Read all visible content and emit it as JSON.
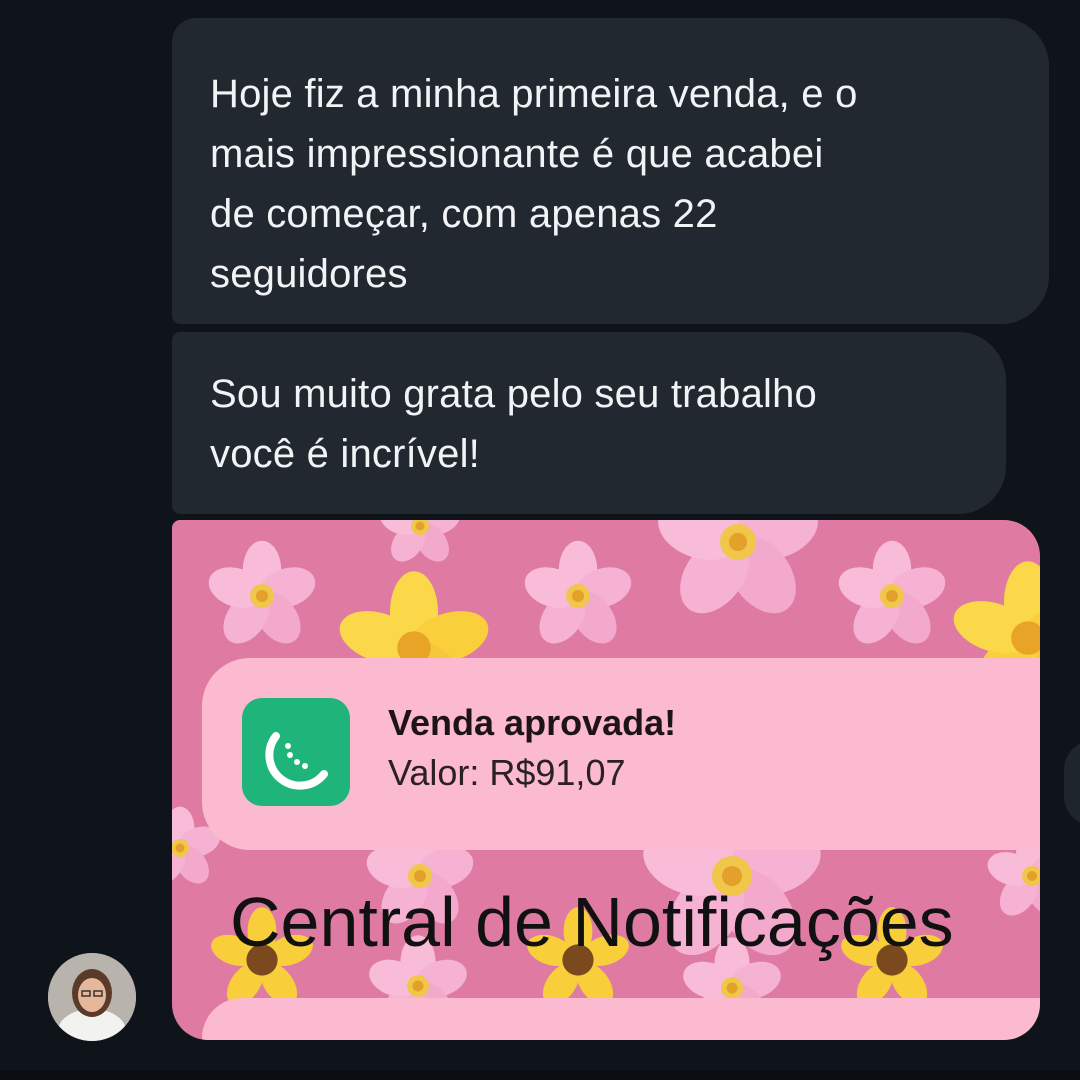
{
  "messages": [
    {
      "lines": [
        "Hoje fiz a minha primeira venda, e o",
        "mais impressionante é que acabei",
        "de começar, com apenas 22",
        "seguidores"
      ]
    },
    {
      "lines": [
        "Sou muito grata pelo seu trabalho",
        "você é incrível!"
      ]
    }
  ],
  "image": {
    "notification": {
      "title": "Venda aprovada!",
      "value": "Valor: R$91,07",
      "icon": "melon-slice-icon"
    },
    "center_title": "Central de Notificações"
  },
  "avatar": {
    "icon": "user-avatar"
  },
  "colors": {
    "background": "#0f141a",
    "bubble": "#222830",
    "image_bg": "#df7ba3",
    "notification_bg": "#fbbacf",
    "app_icon": "#1fb57a"
  }
}
